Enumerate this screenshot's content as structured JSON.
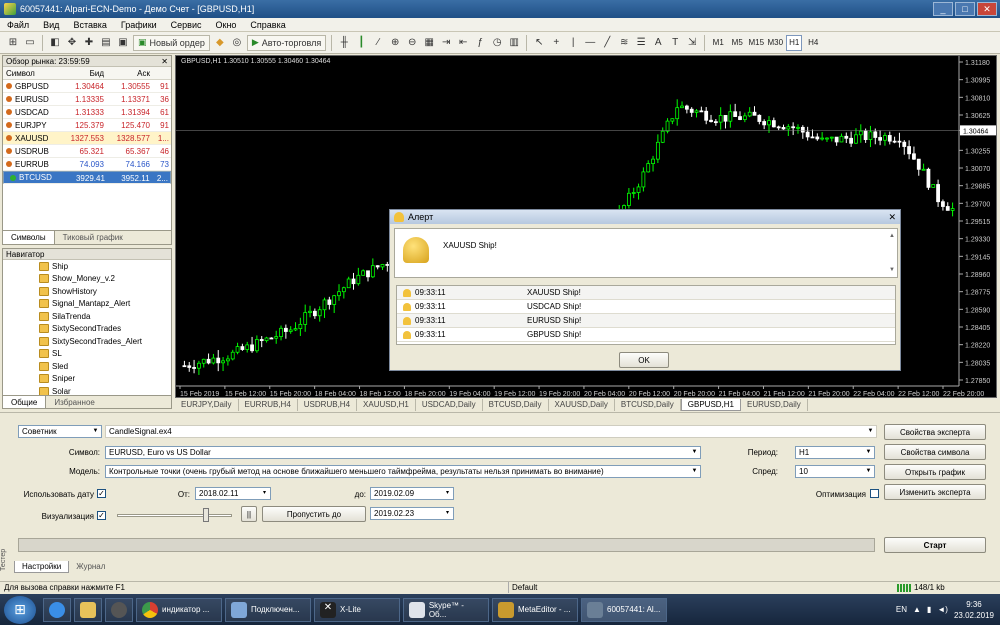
{
  "window": {
    "title": "60057441: Alpari-ECN-Demo - Демо Счет - [GBPUSD,H1]",
    "controls": [
      "_",
      "□",
      "✕"
    ]
  },
  "menu": [
    "Файл",
    "Вид",
    "Вставка",
    "Графики",
    "Сервис",
    "Окно",
    "Справка"
  ],
  "toolbar": {
    "new_order": "Новый ордер",
    "autotrading": "Авто-торговля",
    "timeframes": [
      "M1",
      "M5",
      "M15",
      "M30",
      "H1",
      "H4"
    ],
    "active_tf": "H1"
  },
  "market_watch": {
    "title": "Обзор рынка: 23:59:59",
    "columns": [
      "Символ",
      "Бид",
      "Аск",
      ""
    ],
    "rows": [
      {
        "symbol": "GBPUSD",
        "bid": "1.30464",
        "ask": "1.30555",
        "spread": "91"
      },
      {
        "symbol": "EURUSD",
        "bid": "1.13335",
        "ask": "1.13371",
        "spread": "36"
      },
      {
        "symbol": "USDCAD",
        "bid": "1.31333",
        "ask": "1.31394",
        "spread": "61"
      },
      {
        "symbol": "EURJPY",
        "bid": "125.379",
        "ask": "125.470",
        "spread": "91"
      },
      {
        "symbol": "XAUUSD",
        "bid": "1327.553",
        "ask": "1328.577",
        "spread": "1..."
      },
      {
        "symbol": "USDRUB",
        "bid": "65.321",
        "ask": "65.367",
        "spread": "46"
      },
      {
        "symbol": "EURRUB",
        "bid": "74.093",
        "ask": "74.166",
        "spread": "73"
      },
      {
        "symbol": "BTCUSD",
        "bid": "3929.41",
        "ask": "3952.11",
        "spread": "2..."
      }
    ],
    "tabs": [
      "Символы",
      "Тиковый график"
    ]
  },
  "navigator": {
    "title": "Навигатор",
    "items": [
      "Ship",
      "Show_Money_v.2",
      "ShowHistory",
      "Signal_Mantapz_Alert",
      "SilaTrenda",
      "SixtySecondTrades",
      "SixtySecondTrades_Alert",
      "SL",
      "Sled",
      "Sniper",
      "Solar"
    ],
    "tabs": [
      "Общие",
      "Избранное"
    ]
  },
  "chart": {
    "header": "GBPUSD,H1  1.30510 1.30555 1.30460 1.30464",
    "price_labels": [
      "1.31180",
      "1.30995",
      "1.30810",
      "1.30625",
      "1.30464",
      "1.30255",
      "1.30070",
      "1.29885",
      "1.29700",
      "1.29515",
      "1.29330",
      "1.29145",
      "1.28960",
      "1.28775",
      "1.28590",
      "1.28405",
      "1.28220",
      "1.28035",
      "1.27850"
    ],
    "current_price": "1.30464",
    "time_labels": [
      "15 Feb 2019",
      "15 Feb 12:00",
      "15 Feb 20:00",
      "18 Feb 04:00",
      "18 Feb 12:00",
      "18 Feb 20:00",
      "19 Feb 04:00",
      "19 Feb 12:00",
      "19 Feb 20:00",
      "20 Feb 04:00",
      "20 Feb 12:00",
      "20 Feb 20:00",
      "21 Feb 04:00",
      "21 Feb 12:00",
      "21 Feb 20:00",
      "22 Feb 04:00",
      "22 Feb 12:00",
      "22 Feb 20:00"
    ],
    "tabs": [
      "EURJPY,Daily",
      "EURRUB,H4",
      "USDRUB,H4",
      "XAUUSD,H1",
      "USDCAD,Daily",
      "BTCUSD,Daily",
      "XAUUSD,Daily",
      "BTCUSD,Daily",
      "GBPUSD,H1",
      "EURUSD,Daily"
    ],
    "active_tab": "GBPUSD,H1",
    "colors": {
      "bull": "#00ff00",
      "bear": "#ffffff",
      "bg": "#000000"
    }
  },
  "alert": {
    "title": "Алерт",
    "message": "XAUUSD Ship!",
    "rows": [
      {
        "time": "09:33:11",
        "text": "XAUUSD Ship!"
      },
      {
        "time": "09:33:11",
        "text": "USDCAD Ship!"
      },
      {
        "time": "09:33:11",
        "text": "EURUSD Ship!"
      },
      {
        "time": "09:33:11",
        "text": "GBPUSD Ship!"
      }
    ],
    "ok": "OK"
  },
  "tester": {
    "type": "Советник",
    "ea": "CandleSignal.ex4",
    "symbol_label": "Символ:",
    "symbol": "EURUSD, Euro vs US Dollar",
    "model_label": "Модель:",
    "model": "Контрольные точки (очень грубый метод на основе ближайшего меньшего таймфрейма, результаты нельзя принимать во внимание)",
    "use_date": "Использовать дату",
    "from_label": "От:",
    "from": "2018.02.11",
    "to_label": "до:",
    "to": "2019.02.09",
    "visual": "Визуализация",
    "skip": "Пропустить до",
    "skip_date": "2019.02.23",
    "period_label": "Период:",
    "period": "H1",
    "spread_label": "Спред:",
    "spread": "10",
    "optimization": "Оптимизация",
    "buttons": {
      "expert_props": "Свойства эксперта",
      "symbol_props": "Свойства символа",
      "open_chart": "Открыть график",
      "modify_expert": "Изменить эксперта",
      "start": "Старт",
      "pause": "||"
    },
    "tabs": [
      "Настройки",
      "Журнал"
    ],
    "side": "Тестер"
  },
  "status": {
    "help": "Для вызова справки нажмите F1",
    "profile": "Default",
    "traffic": "148/1 kb"
  },
  "taskbar": {
    "items": [
      "индикатор ...",
      "Подключен...",
      "X-Lite",
      "Skype™ - Об...",
      "MetaEditor - ...",
      "60057441: Al..."
    ],
    "lang": "EN",
    "time": "9:36",
    "date": "23.02.2019"
  }
}
